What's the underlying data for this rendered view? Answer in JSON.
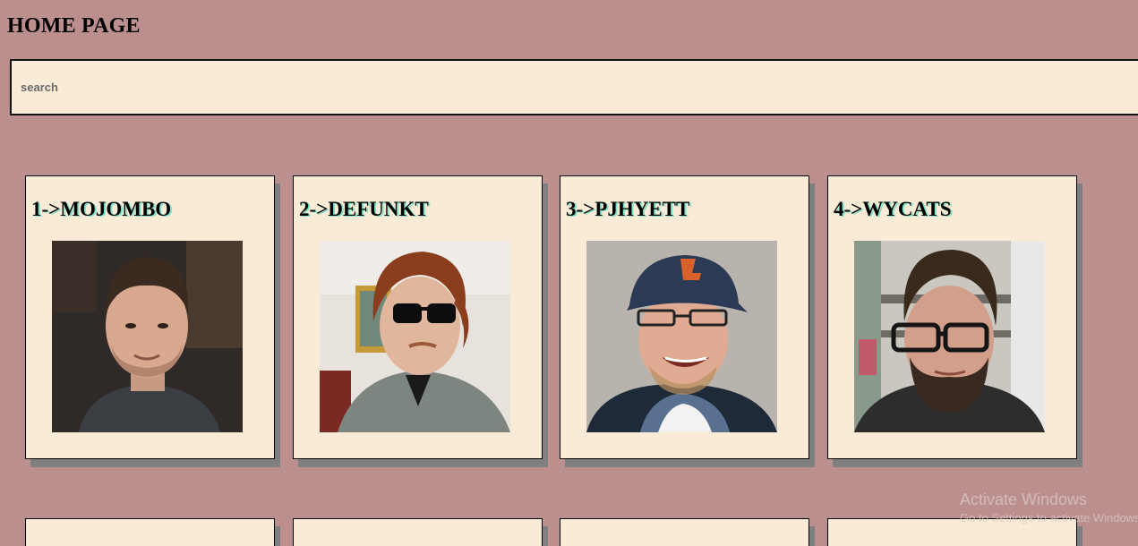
{
  "header": {
    "title": "HOME PAGE"
  },
  "search": {
    "placeholder": "search",
    "value": ""
  },
  "users": [
    {
      "label": "1->MOJOMBO"
    },
    {
      "label": "2->DEFUNKT"
    },
    {
      "label": "3->PJHYETT"
    },
    {
      "label": "4->WYCATS"
    }
  ],
  "watermark": {
    "title": "Activate Windows",
    "subtitle": "Go to Settings to activate Windows."
  },
  "colors": {
    "page_background": "#bc8f8f",
    "card_background": "#faebd7",
    "card_shadow": "#808080",
    "title_text_shadow": "#7fe3c9"
  }
}
